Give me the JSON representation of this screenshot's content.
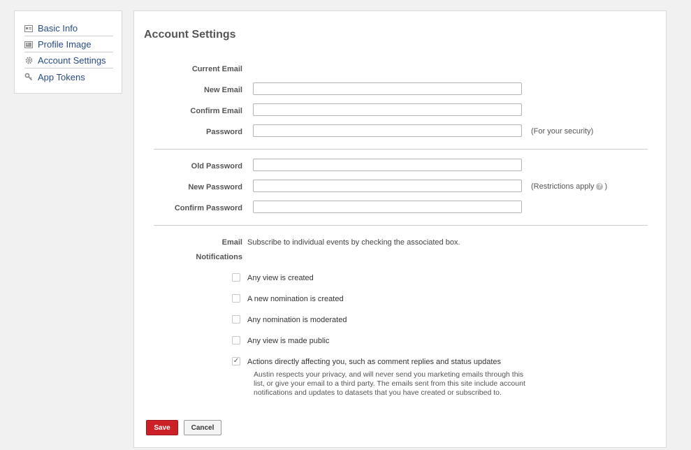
{
  "sidebar": {
    "items": [
      {
        "label": "Basic Info",
        "icon": "id-card-icon"
      },
      {
        "label": "Profile Image",
        "icon": "image-icon"
      },
      {
        "label": "Account Settings",
        "icon": "gear-icon"
      },
      {
        "label": "App Tokens",
        "icon": "key-icon"
      }
    ]
  },
  "main": {
    "title": "Account Settings",
    "email_section": {
      "current_email_label": "Current Email",
      "current_email_value": "",
      "new_email_label": "New Email",
      "new_email_value": "",
      "confirm_email_label": "Confirm Email",
      "confirm_email_value": "",
      "password_label": "Password",
      "password_value": "",
      "password_hint": "(For your security)"
    },
    "password_section": {
      "old_password_label": "Old Password",
      "new_password_label": "New Password",
      "new_password_hint_prefix": "(Restrictions apply",
      "new_password_hint_suffix": ")",
      "help_icon_glyph": "?",
      "confirm_password_label": "Confirm Password"
    },
    "notifications": {
      "label_line1": "Email",
      "label_line2": "Notifications",
      "description": "Subscribe to individual events by checking the associated box.",
      "options": [
        {
          "label": "Any view is created",
          "checked": false
        },
        {
          "label": "A new nomination is created",
          "checked": false
        },
        {
          "label": "Any nomination is moderated",
          "checked": false
        },
        {
          "label": "Any view is made public",
          "checked": false
        },
        {
          "label": "Actions directly affecting you, such as comment replies and status updates",
          "checked": true
        }
      ],
      "privacy_note": "Austin respects your privacy, and will never send you marketing emails through this list, or give your email to a third party. The emails sent from this site include account notifications and updates to datasets that you have created or subscribed to."
    },
    "buttons": {
      "save_label": "Save",
      "cancel_label": "Cancel"
    }
  },
  "colors": {
    "link": "#2b4a8c",
    "save_button": "#cc2027",
    "page_background": "#f1f1f1"
  }
}
